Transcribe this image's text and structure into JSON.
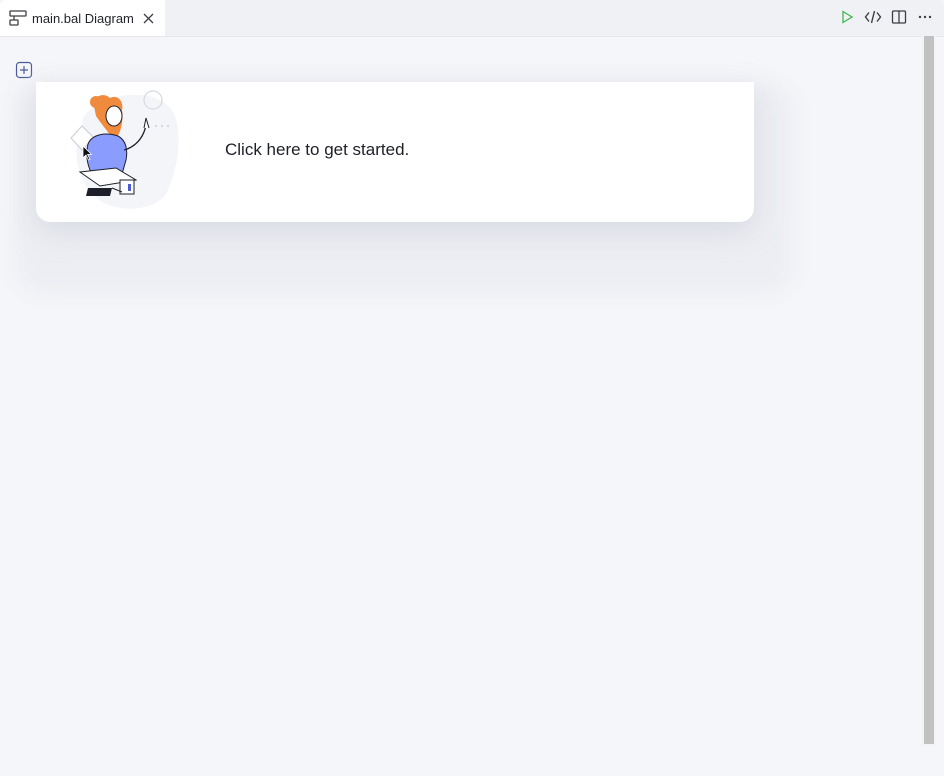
{
  "tab": {
    "label": "main.bal Diagram",
    "icon": "diagram-icon"
  },
  "toolbar": {
    "actions": [
      "run-icon",
      "code-icon",
      "split-editor-icon",
      "more-actions-icon"
    ],
    "run_color": "#3fb950"
  },
  "canvas": {
    "add_button_icon": "add-square-icon",
    "prompt_text": "Click here to get started.",
    "accent": "#8b9cff",
    "background": "#f5f6f9"
  }
}
